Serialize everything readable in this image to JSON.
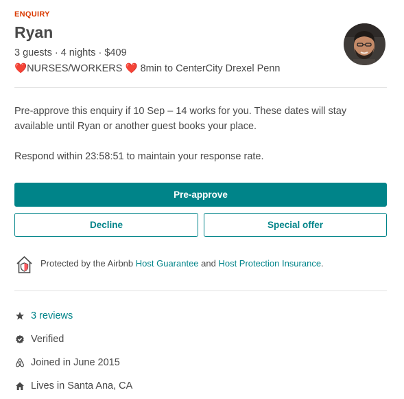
{
  "enquiry": {
    "badge": "ENQUIRY",
    "guest_name": "Ryan",
    "trip_details": "3 guests · 4 nights · $409",
    "listing": {
      "heart_left": "❤️",
      "text_part1": "NURSES/WORKERS ",
      "heart_right": "❤️",
      "text_part2": " 8min to CenterCity Drexel Penn"
    }
  },
  "message": {
    "body": "Pre-approve this enquiry if 10 Sep – 14 works for you. These dates will stay available until Ryan or another guest books your place.",
    "respond": "Respond within 23:58:51 to maintain your response rate."
  },
  "actions": {
    "preapprove_label": "Pre-approve",
    "decline_label": "Decline",
    "special_offer_label": "Special offer"
  },
  "protection": {
    "prefix": "Protected by the Airbnb ",
    "link1": "Host Guarantee",
    "middle": " and ",
    "link2": "Host Protection Insurance",
    "suffix": "."
  },
  "guest_facts": [
    {
      "icon": "star-icon",
      "label": "3 reviews",
      "is_link": true
    },
    {
      "icon": "verified-check-icon",
      "label": "Verified",
      "is_link": false
    },
    {
      "icon": "airbnb-logo-icon",
      "label": "Joined in June 2015",
      "is_link": false
    },
    {
      "icon": "house-icon",
      "label": "Lives in Santa Ana, CA",
      "is_link": false
    }
  ],
  "colors": {
    "accent": "#008489",
    "badge": "#d93900",
    "text": "#484848",
    "divider": "#e4e4e4"
  }
}
